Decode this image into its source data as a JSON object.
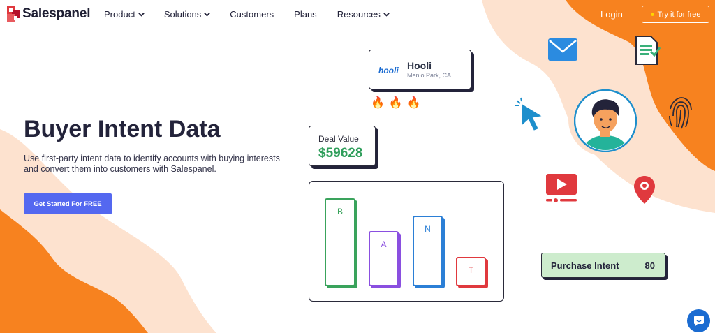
{
  "brand": {
    "name": "Salespanel"
  },
  "nav": {
    "items": [
      {
        "label": "Product",
        "has_dropdown": true
      },
      {
        "label": "Solutions",
        "has_dropdown": true
      },
      {
        "label": "Customers",
        "has_dropdown": false
      },
      {
        "label": "Plans",
        "has_dropdown": false
      },
      {
        "label": "Resources",
        "has_dropdown": true
      }
    ],
    "login_label": "Login",
    "try_label": "Try it for free"
  },
  "hero": {
    "title": "Buyer Intent Data",
    "description": "Use first-party intent data to identify accounts with buying interests and convert them into customers with Salespanel.",
    "cta_label": "Get Started For FREE"
  },
  "company_card": {
    "logo_text": "hooli",
    "name": "Hooli",
    "location": "Menlo Park, CA"
  },
  "deal_card": {
    "label": "Deal Value",
    "value": "$59628"
  },
  "flames": [
    "🔥",
    "🔥",
    "🔥"
  ],
  "bars_chart": {
    "bars": [
      {
        "letter": "B",
        "color": "#3aa35c"
      },
      {
        "letter": "A",
        "color": "#8a4fe0"
      },
      {
        "letter": "N",
        "color": "#2b7fd6"
      },
      {
        "letter": "T",
        "color": "#e0393e"
      }
    ]
  },
  "intent": {
    "label": "Purchase Intent",
    "value": "80"
  },
  "icons": [
    "mail-icon",
    "document-check-icon",
    "cursor-click-icon",
    "fingerprint-icon",
    "video-play-icon",
    "location-pin-icon",
    "chat-icon"
  ],
  "colors": {
    "accent_orange": "#f7821f",
    "light_orange": "#fde2cf",
    "cta_blue": "#5468f0",
    "deal_green": "#2f9e5b",
    "intent_bg": "#cdeccd",
    "chat_blue": "#1a6bd1"
  }
}
